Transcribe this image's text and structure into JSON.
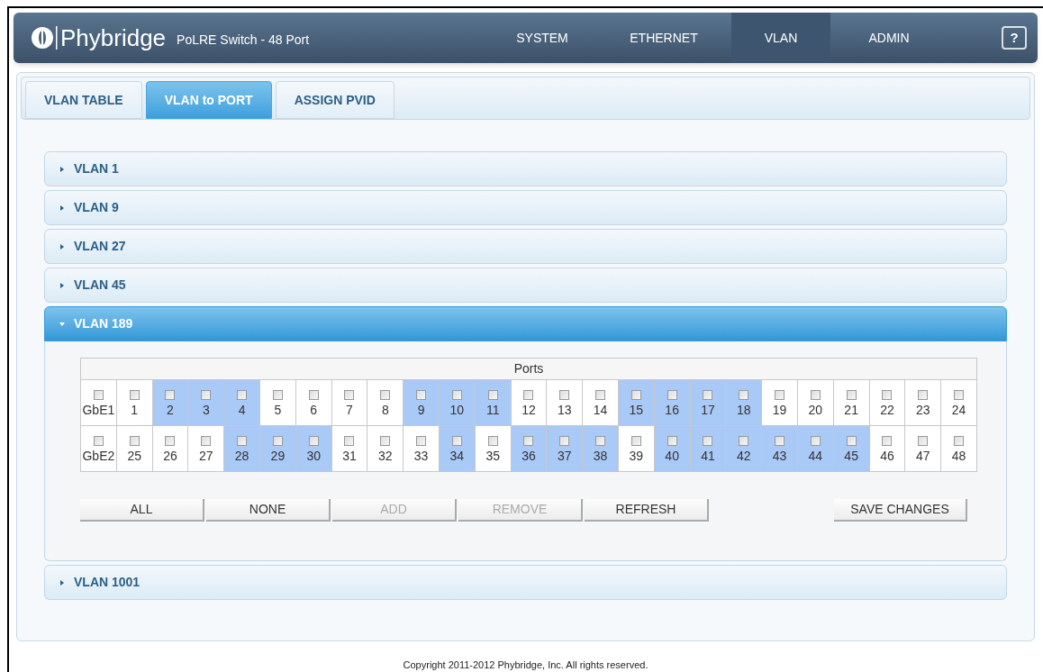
{
  "brand": {
    "name": "Phybridge",
    "product": "PoLRE Switch - 48 Port"
  },
  "nav": [
    {
      "label": "SYSTEM",
      "selected": false
    },
    {
      "label": "ETHERNET",
      "selected": false
    },
    {
      "label": "VLAN",
      "selected": true
    },
    {
      "label": "ADMIN",
      "selected": false
    }
  ],
  "help": "?",
  "tabs": [
    {
      "label": "VLAN TABLE",
      "selected": false
    },
    {
      "label": "VLAN to PORT",
      "selected": true
    },
    {
      "label": "ASSIGN PVID",
      "selected": false
    }
  ],
  "vlans": [
    {
      "label": "VLAN 1",
      "expanded": false
    },
    {
      "label": "VLAN 9",
      "expanded": false
    },
    {
      "label": "VLAN 27",
      "expanded": false
    },
    {
      "label": "VLAN 45",
      "expanded": false
    },
    {
      "label": "VLAN 189",
      "expanded": true,
      "ports_title": "Ports",
      "rows": [
        [
          {
            "label": "GbE1",
            "member": false,
            "checked": false
          },
          {
            "label": "1",
            "member": false,
            "checked": false
          },
          {
            "label": "2",
            "member": true,
            "checked": false
          },
          {
            "label": "3",
            "member": true,
            "checked": false
          },
          {
            "label": "4",
            "member": true,
            "checked": false
          },
          {
            "label": "5",
            "member": false,
            "checked": false
          },
          {
            "label": "6",
            "member": false,
            "checked": false
          },
          {
            "label": "7",
            "member": false,
            "checked": false
          },
          {
            "label": "8",
            "member": false,
            "checked": false
          },
          {
            "label": "9",
            "member": true,
            "checked": false
          },
          {
            "label": "10",
            "member": true,
            "checked": false
          },
          {
            "label": "11",
            "member": true,
            "checked": false
          },
          {
            "label": "12",
            "member": false,
            "checked": false
          },
          {
            "label": "13",
            "member": false,
            "checked": false
          },
          {
            "label": "14",
            "member": false,
            "checked": false
          },
          {
            "label": "15",
            "member": true,
            "checked": false
          },
          {
            "label": "16",
            "member": true,
            "checked": false
          },
          {
            "label": "17",
            "member": true,
            "checked": false
          },
          {
            "label": "18",
            "member": true,
            "checked": false
          },
          {
            "label": "19",
            "member": false,
            "checked": false
          },
          {
            "label": "20",
            "member": false,
            "checked": false
          },
          {
            "label": "21",
            "member": false,
            "checked": false
          },
          {
            "label": "22",
            "member": false,
            "checked": false
          },
          {
            "label": "23",
            "member": false,
            "checked": false
          },
          {
            "label": "24",
            "member": false,
            "checked": false
          }
        ],
        [
          {
            "label": "GbE2",
            "member": false,
            "checked": false
          },
          {
            "label": "25",
            "member": false,
            "checked": false
          },
          {
            "label": "26",
            "member": false,
            "checked": false
          },
          {
            "label": "27",
            "member": false,
            "checked": false
          },
          {
            "label": "28",
            "member": true,
            "checked": false
          },
          {
            "label": "29",
            "member": true,
            "checked": false
          },
          {
            "label": "30",
            "member": true,
            "checked": false
          },
          {
            "label": "31",
            "member": false,
            "checked": false
          },
          {
            "label": "32",
            "member": false,
            "checked": false
          },
          {
            "label": "33",
            "member": false,
            "checked": false
          },
          {
            "label": "34",
            "member": true,
            "checked": false
          },
          {
            "label": "35",
            "member": false,
            "checked": false
          },
          {
            "label": "36",
            "member": true,
            "checked": false
          },
          {
            "label": "37",
            "member": true,
            "checked": false
          },
          {
            "label": "38",
            "member": true,
            "checked": false
          },
          {
            "label": "39",
            "member": false,
            "checked": false
          },
          {
            "label": "40",
            "member": true,
            "checked": false
          },
          {
            "label": "41",
            "member": true,
            "checked": false
          },
          {
            "label": "42",
            "member": true,
            "checked": false
          },
          {
            "label": "43",
            "member": true,
            "checked": false
          },
          {
            "label": "44",
            "member": true,
            "checked": false
          },
          {
            "label": "45",
            "member": true,
            "checked": false
          },
          {
            "label": "46",
            "member": false,
            "checked": false
          },
          {
            "label": "47",
            "member": false,
            "checked": false
          },
          {
            "label": "48",
            "member": false,
            "checked": false
          }
        ]
      ],
      "buttons": [
        {
          "label": "ALL",
          "disabled": false
        },
        {
          "label": "NONE",
          "disabled": false
        },
        {
          "label": "ADD",
          "disabled": true
        },
        {
          "label": "REMOVE",
          "disabled": true
        },
        {
          "label": "REFRESH",
          "disabled": false
        }
      ],
      "save_button": {
        "label": "SAVE CHANGES",
        "disabled": false
      }
    },
    {
      "label": "VLAN 1001",
      "expanded": false
    }
  ],
  "footer": "Copyright 2011-2012 Phybridge, Inc. All rights reserved."
}
